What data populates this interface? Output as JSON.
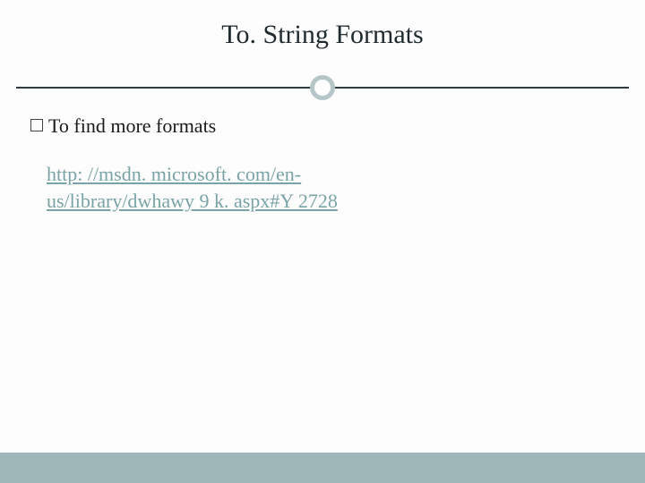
{
  "title": "To. String Formats",
  "bullet_text": "To find more formats",
  "link": {
    "line1": "http: //msdn. microsoft. com/en-",
    "line2": "us/library/dwhawy 9 k. aspx#Y 2728",
    "href": "http://msdn.microsoft.com/en-us/library/dwhawy9k.aspx#Y2728"
  }
}
